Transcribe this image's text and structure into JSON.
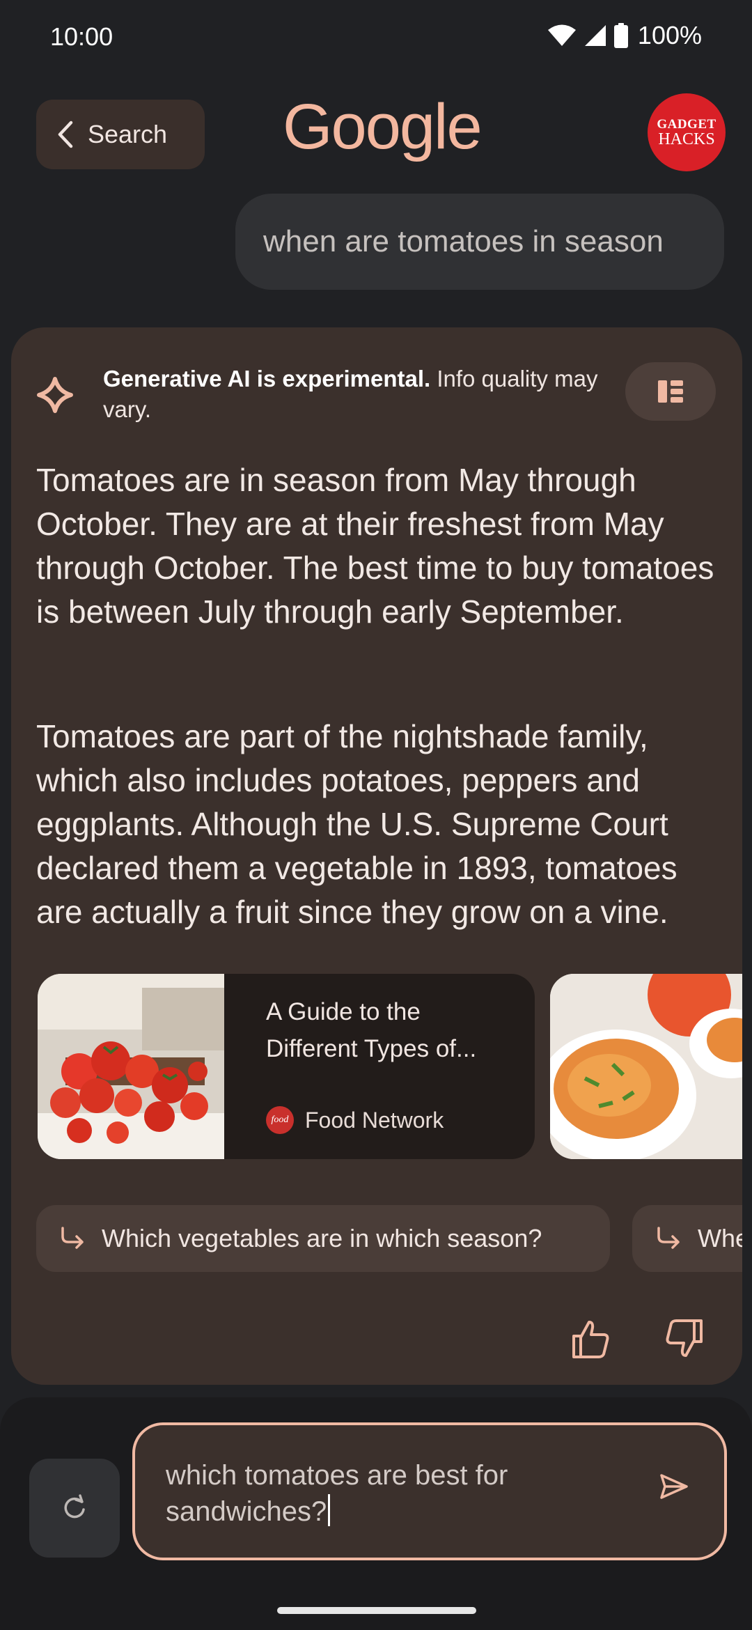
{
  "status_bar": {
    "time": "10:00",
    "battery": "100%"
  },
  "header": {
    "back_label": "Search",
    "logo_text": "Google",
    "avatar_line1": "GADGET",
    "avatar_line2": "HACKS"
  },
  "query": "when are tomatoes in season",
  "answer": {
    "disclaimer_bold": "Generative AI is experimental.",
    "disclaimer_rest": " Info quality may vary.",
    "paragraph_1": "Tomatoes are in season from May through October. They are at their freshest from May through October. The best time to buy tomatoes is between July through early September.",
    "paragraph_2": "Tomatoes are part of the nightshade family, which also includes potatoes, peppers and eggplants. Although the U.S. Supreme Court declared them a vegetable in 1893, tomatoes are actually a fruit since they grow on a vine.",
    "source": {
      "title": "A Guide to the Different Types of...",
      "publisher": "Food Network",
      "publisher_logo_text": "food"
    },
    "followups": [
      "Which vegetables are in which season?",
      "Whe"
    ]
  },
  "composer": {
    "input_value": "which tomatoes are best for sandwiches?"
  },
  "colors": {
    "accent": "#f0b9a3",
    "card_bg": "#3b302c",
    "page_bg": "#202124"
  },
  "icons": [
    "wifi-icon",
    "signal-icon",
    "battery-icon",
    "chevron-left-icon",
    "sparkle-icon",
    "view-toggle-icon",
    "follow-up-arrow-icon",
    "thumb-up-icon",
    "thumb-down-icon",
    "reset-icon",
    "send-icon"
  ]
}
